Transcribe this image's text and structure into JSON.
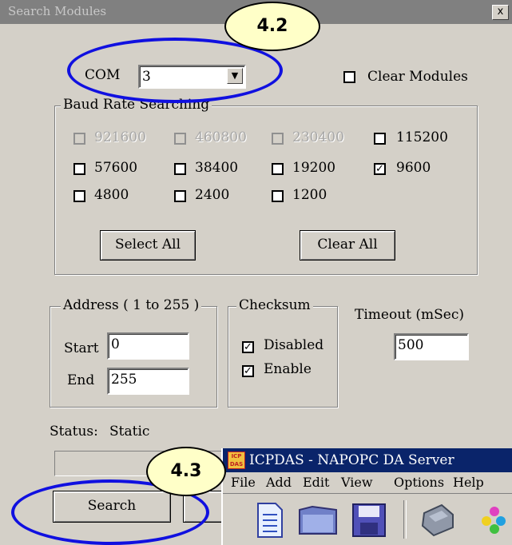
{
  "dialog": {
    "title": "Search Modules",
    "close_label": "x",
    "com_label": "COM",
    "com_value": "3",
    "clear_modules_label": "Clear Modules",
    "baud_group_label": "Baud Rate Searching",
    "baud_rates": [
      {
        "label": "921600",
        "checked": false,
        "enabled": false
      },
      {
        "label": "460800",
        "checked": false,
        "enabled": false
      },
      {
        "label": "230400",
        "checked": false,
        "enabled": false
      },
      {
        "label": "115200",
        "checked": false,
        "enabled": true
      },
      {
        "label": "57600",
        "checked": false,
        "enabled": true
      },
      {
        "label": "38400",
        "checked": false,
        "enabled": true
      },
      {
        "label": "19200",
        "checked": false,
        "enabled": true
      },
      {
        "label": "9600",
        "checked": true,
        "enabled": true
      },
      {
        "label": "4800",
        "checked": false,
        "enabled": true
      },
      {
        "label": "2400",
        "checked": false,
        "enabled": true
      },
      {
        "label": "1200",
        "checked": false,
        "enabled": true
      }
    ],
    "select_all_label": "Select All",
    "clear_all_label": "Clear All",
    "address_group_label": "Address ( 1 to 255 )",
    "start_label": "Start",
    "start_value": "0",
    "end_label": "End",
    "end_value": "255",
    "checksum_group_label": "Checksum",
    "checksum_disabled_label": "Disabled",
    "checksum_enabled_label": "Enable",
    "timeout_label": "Timeout (mSec)",
    "timeout_value": "500",
    "status_label": "Status:",
    "status_value": "Static",
    "search_label": "Search"
  },
  "callouts": {
    "step_com": "4.2",
    "step_search": "4.3"
  },
  "popup": {
    "title": "ICPDAS - NAPOPC DA Server",
    "icon_text": "ICP DAS",
    "menu": [
      "File",
      "Add",
      "Edit",
      "View",
      "Options",
      "Help"
    ]
  },
  "colors": {
    "dialog_bg": "#d4d0c8",
    "callout_ring": "#1010e0",
    "badge_fill": "#ffffc8",
    "popup_titlebar": "#0a246a"
  }
}
